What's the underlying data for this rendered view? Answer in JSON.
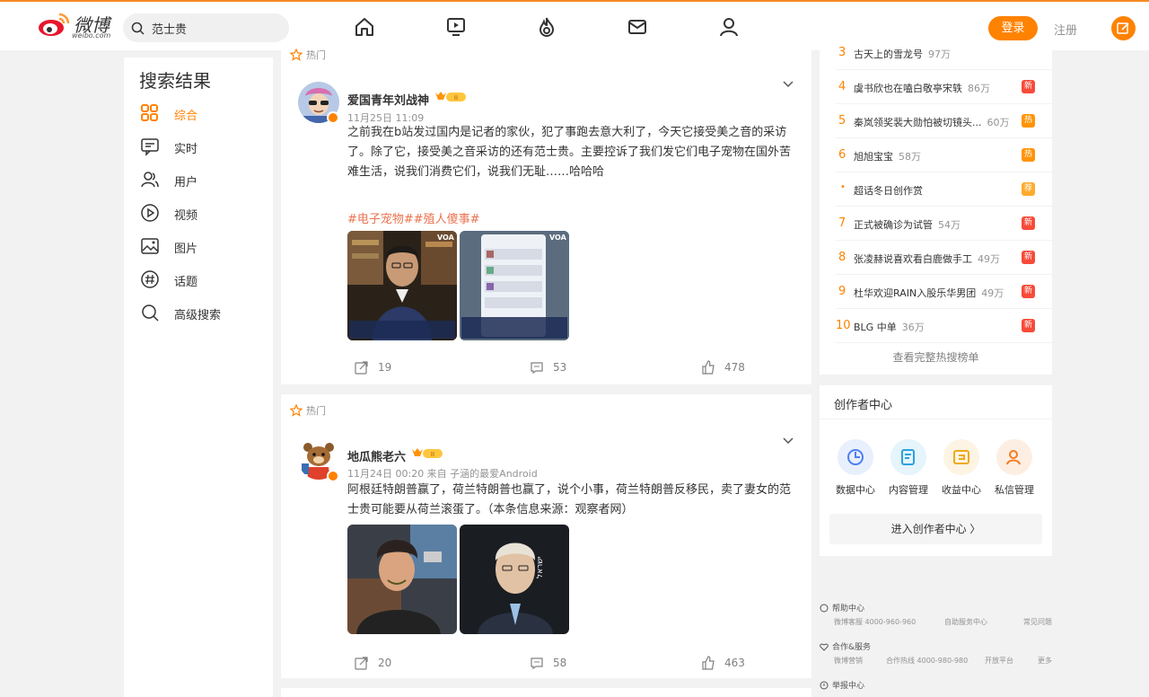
{
  "header": {
    "logo_text": "微博",
    "logo_sub": "weibo.com",
    "search_value": "范士贵",
    "login_label": "登录",
    "register_label": "注册",
    "nav_icons": [
      "home-icon",
      "video-icon",
      "hot-icon",
      "message-icon",
      "profile-icon"
    ]
  },
  "sidebar": {
    "title": "搜索结果",
    "items": [
      {
        "label": "综合",
        "icon": "grid-icon",
        "active": true
      },
      {
        "label": "实时",
        "icon": "realtime-icon"
      },
      {
        "label": "用户",
        "icon": "user-icon"
      },
      {
        "label": "视频",
        "icon": "video-icon"
      },
      {
        "label": "图片",
        "icon": "image-icon"
      },
      {
        "label": "话题",
        "icon": "topic-icon"
      },
      {
        "label": "高级搜索",
        "icon": "search-icon"
      }
    ]
  },
  "posts": [
    {
      "hot_label": "热门",
      "user": "爱国青年刘战神",
      "meta": "11月25日 11:09",
      "text": "之前我在b站发过国内是记者的家伙，犯了事跑去意大利了，今天它接受美之音的采访了。除了它，接受美之音采访的还有范士贵。主要控诉了我们发它们电子宠物在国外苦难生活，说我们消费它们，说我们无耻……哈哈哈",
      "topic": "#电子宠物##殖人傻事#",
      "reposts": "19",
      "comments": "53",
      "likes": "478",
      "thumb_captions": [
        "VOA",
        "VOA"
      ]
    },
    {
      "hot_label": "热门",
      "user": "地瓜熊老六",
      "meta": "11月24日 00:20  来自 子涵的最爱Android",
      "text": "阿根廷特朗普赢了，荷兰特朗普也赢了，说个小事，荷兰特朗普反移民，卖了妻女的范士贵可能要从荷兰滚蛋了。（本条信息来源：观察者网）",
      "reposts": "20",
      "comments": "58",
      "likes": "463"
    }
  ],
  "hot_search": {
    "rows": [
      {
        "rank": "3",
        "title": "古天上的雪龙号",
        "count": "97万",
        "badge": ""
      },
      {
        "rank": "4",
        "title": "虞书欣也在嗑白敬亭宋轶",
        "count": "86万",
        "badge": "新",
        "badge_color": "#f74b3a"
      },
      {
        "rank": "5",
        "title": "秦岚领奖裴大勋怕被切镜头...",
        "count": "60万",
        "badge": "热",
        "badge_color": "#ff9406"
      },
      {
        "rank": "6",
        "title": "旭旭宝宝",
        "count": "58万",
        "badge": "热",
        "badge_color": "#ff9406"
      },
      {
        "rank": "•",
        "title": "超话冬日创作赏",
        "count": "",
        "badge": "荐",
        "badge_color": "#ffab2d"
      },
      {
        "rank": "7",
        "title": "正式被确诊为试管",
        "count": "54万",
        "badge": "新",
        "badge_color": "#f74b3a"
      },
      {
        "rank": "8",
        "title": "张凌赫说喜欢看白鹿做手工",
        "count": "49万",
        "badge": "新",
        "badge_color": "#f74b3a"
      },
      {
        "rank": "9",
        "title": "杜华欢迎RAIN入股乐华男团",
        "count": "49万",
        "badge": "新",
        "badge_color": "#f74b3a"
      },
      {
        "rank": "10",
        "title": "BLG 中单",
        "count": "36万",
        "badge": "新",
        "badge_color": "#f74b3a"
      }
    ],
    "more_label": "查看完整热搜榜单"
  },
  "creator": {
    "title": "创作者中心",
    "items": [
      {
        "label": "数据中心",
        "icon": "data-icon",
        "color": "#e8effd",
        "stroke": "#4e7ff0"
      },
      {
        "label": "内容管理",
        "icon": "content-icon",
        "color": "#e6f4fb",
        "stroke": "#29a2de"
      },
      {
        "label": "收益中心",
        "icon": "income-icon",
        "color": "#fdf4e3",
        "stroke": "#f0a919"
      },
      {
        "label": "私信管理",
        "icon": "dm-icon",
        "color": "#fdeee3",
        "stroke": "#f57d22"
      }
    ],
    "enter_label": "进入创作者中心  〉"
  },
  "footer": {
    "help": {
      "title": "帮助中心",
      "links": [
        "微博客服 4000-960-960",
        "自助服务中心",
        "常见问题"
      ]
    },
    "coop": {
      "title": "合作&服务",
      "links": [
        "微博营销",
        "合作热线 4000-980-980",
        "开放平台",
        "更多"
      ]
    },
    "report": {
      "title": "举报中心"
    }
  }
}
